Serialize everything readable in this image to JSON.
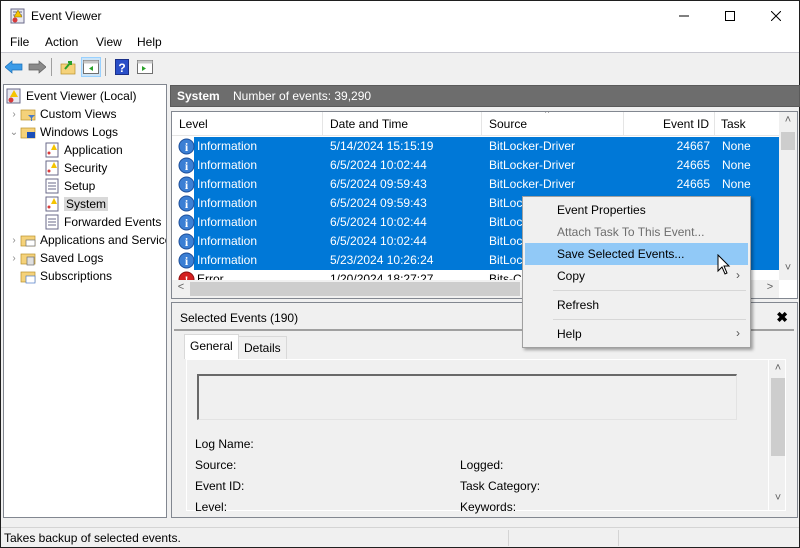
{
  "window": {
    "title": "Event Viewer",
    "controls": {
      "minimize": "minimize",
      "maximize": "maximize",
      "close": "close"
    }
  },
  "menu": [
    "File",
    "Action",
    "View",
    "Help"
  ],
  "toolbar": {
    "buttons": [
      "back-icon",
      "forward-icon",
      "up-folder-icon",
      "show-hide-console-tree-icon",
      "help-icon",
      "show-hide-action-pane-icon"
    ]
  },
  "tree": {
    "items": [
      {
        "label": "Event Viewer (Local)",
        "icon": "event-viewer-icon",
        "expander": ""
      },
      {
        "label": "Custom Views",
        "icon": "filter-folder-icon",
        "expander": ">"
      },
      {
        "label": "Windows Logs",
        "icon": "logs-folder-icon",
        "expander": "v"
      },
      {
        "label": "Application",
        "icon": "log-warning-icon",
        "expander": ""
      },
      {
        "label": "Security",
        "icon": "log-warning-icon",
        "expander": ""
      },
      {
        "label": "Setup",
        "icon": "log-icon",
        "expander": ""
      },
      {
        "label": "System",
        "icon": "log-warning-icon",
        "expander": ""
      },
      {
        "label": "Forwarded Events",
        "icon": "log-icon",
        "expander": ""
      },
      {
        "label": "Applications and Services Logs",
        "icon": "folder-icon",
        "expander": ">"
      },
      {
        "label": "Saved Logs",
        "icon": "folder-icon",
        "expander": ">"
      },
      {
        "label": "Subscriptions",
        "icon": "subscriptions-icon",
        "expander": ""
      }
    ],
    "selected": "System"
  },
  "log_header": {
    "name": "System",
    "count_text": "Number of events: 39,290"
  },
  "grid": {
    "columns": [
      "Level",
      "Date and Time",
      "Source",
      "Event ID",
      "Task Categ"
    ],
    "rows": [
      {
        "level": "Information",
        "datetime": "5/14/2024 15:15:19",
        "source": "BitLocker-Driver",
        "event_id": "24667",
        "task": "None",
        "selected": true
      },
      {
        "level": "Information",
        "datetime": "6/5/2024 10:02:44",
        "source": "BitLocker-Driver",
        "event_id": "24665",
        "task": "None",
        "selected": true
      },
      {
        "level": "Information",
        "datetime": "6/5/2024 09:59:43",
        "source": "BitLocker-Driver",
        "event_id": "24665",
        "task": "None",
        "selected": true
      },
      {
        "level": "Information",
        "datetime": "6/5/2024 09:59:43",
        "source": "BitLocker-Driver",
        "event_id": "",
        "task": "",
        "selected": true
      },
      {
        "level": "Information",
        "datetime": "6/5/2024 10:02:44",
        "source": "BitLocker-Driver",
        "event_id": "",
        "task": "",
        "selected": true
      },
      {
        "level": "Information",
        "datetime": "6/5/2024 10:02:44",
        "source": "BitLocker-Driver",
        "event_id": "",
        "task": "",
        "selected": true
      },
      {
        "level": "Information",
        "datetime": "5/23/2024 10:26:24",
        "source": "BitLocker-Driver",
        "event_id": "",
        "task": "",
        "selected": true
      },
      {
        "level": "Error",
        "datetime": "1/20/2024 18:27:27",
        "source": "Bits-C",
        "event_id": "",
        "task": "",
        "selected": false
      }
    ]
  },
  "details": {
    "title": "Selected Events (190)",
    "tabs": [
      "General",
      "Details"
    ],
    "active_tab": "General",
    "fields_left": [
      "Log Name:",
      "Source:",
      "Event ID:",
      "Level:"
    ],
    "fields_right": [
      "Logged:",
      "Task Category:",
      "Keywords:"
    ]
  },
  "context_menu": {
    "items": [
      {
        "label": "Event Properties",
        "disabled": false,
        "submenu": false
      },
      {
        "label": "Attach Task To This Event...",
        "disabled": true,
        "submenu": false
      },
      {
        "label": "Save Selected Events...",
        "disabled": false,
        "submenu": false,
        "highlighted": true
      },
      {
        "label": "Copy",
        "disabled": false,
        "submenu": true
      },
      {
        "label": "Refresh",
        "disabled": false,
        "submenu": false
      },
      {
        "label": "Help",
        "disabled": false,
        "submenu": true
      }
    ]
  },
  "status_bar": {
    "text": "Takes backup of selected events."
  },
  "colors": {
    "selection": "#0078d7",
    "menu_highlight": "#91c9f7",
    "header_bar": "#6d6d6d"
  }
}
